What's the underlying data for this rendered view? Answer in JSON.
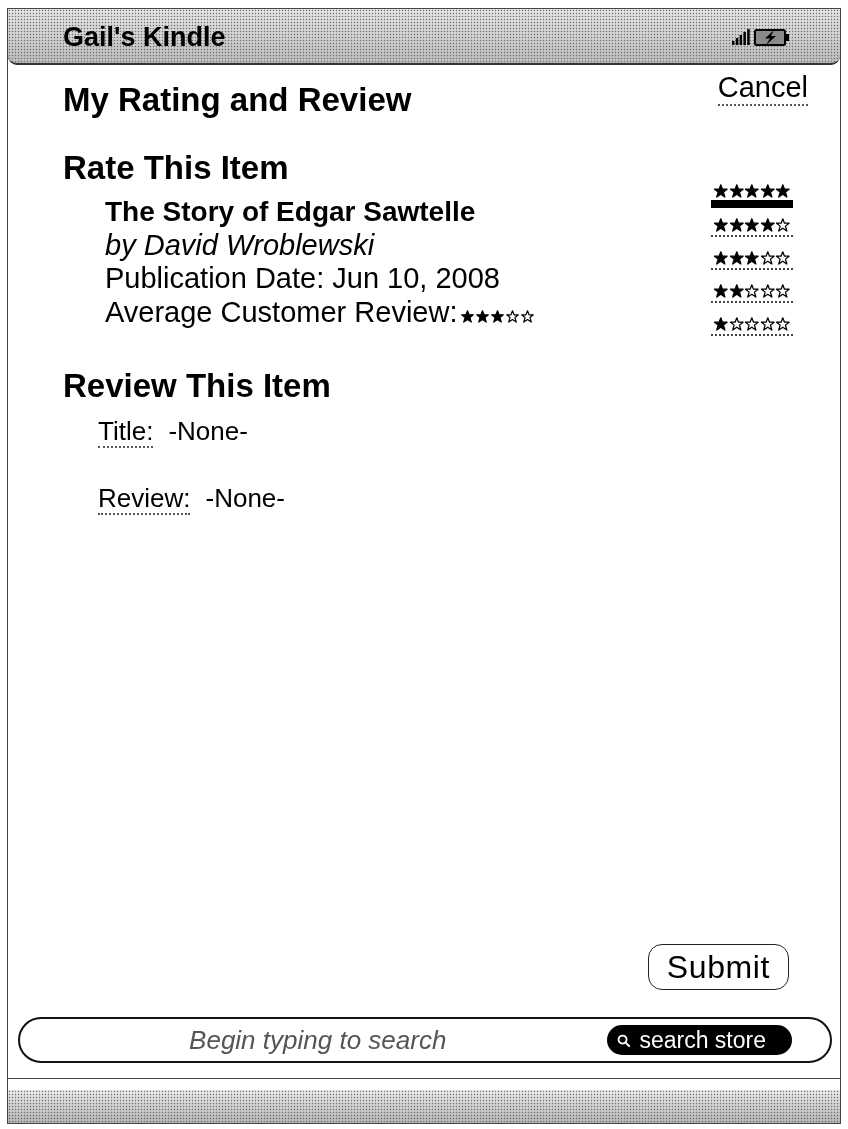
{
  "header": {
    "title": "Gail's Kindle"
  },
  "page": {
    "title": "My Rating and Review",
    "cancel": "Cancel"
  },
  "rate": {
    "heading": "Rate This Item",
    "book": {
      "title": "The Story of Edgar Sawtelle",
      "author": "by David Wroblewski",
      "publication": "Publication Date: Jun 10, 2008",
      "average_review": {
        "label": "Average Customer Review:",
        "stars": 3
      }
    },
    "options": [
      {
        "stars": 5,
        "selected": true
      },
      {
        "stars": 4,
        "selected": false
      },
      {
        "stars": 3,
        "selected": false
      },
      {
        "stars": 2,
        "selected": false
      },
      {
        "stars": 1,
        "selected": false
      }
    ]
  },
  "review": {
    "heading": "Review This Item",
    "fields": [
      {
        "label": "Title:",
        "value": "-None-"
      },
      {
        "label": "Review:",
        "value": "-None-"
      }
    ]
  },
  "submit": "Submit",
  "search": {
    "placeholder": "Begin typing to search",
    "button": "search store"
  }
}
